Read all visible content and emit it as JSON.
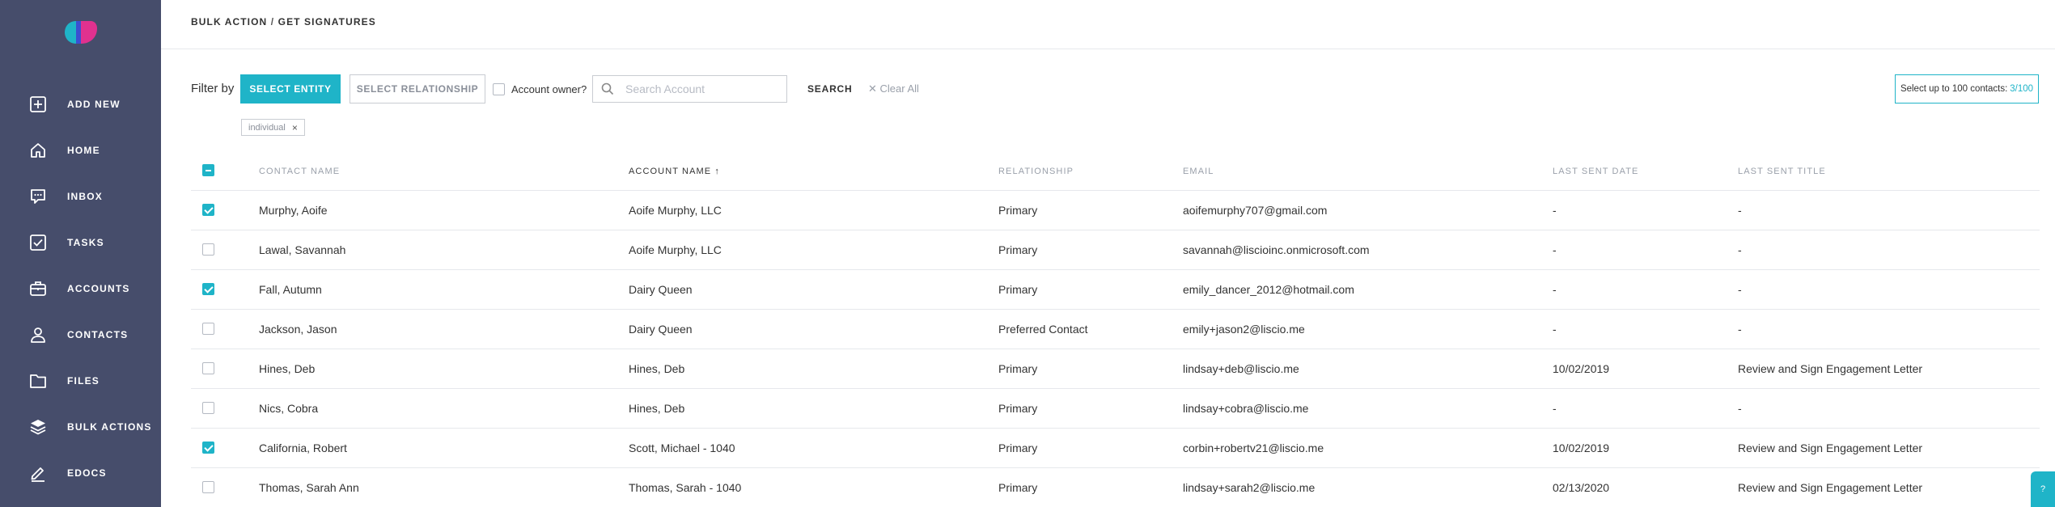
{
  "sidebar": {
    "items": [
      {
        "label": "ADD NEW",
        "icon": "plus-square-icon"
      },
      {
        "label": "HOME",
        "icon": "home-icon"
      },
      {
        "label": "INBOX",
        "icon": "message-icon"
      },
      {
        "label": "TASKS",
        "icon": "checkbox-icon"
      },
      {
        "label": "ACCOUNTS",
        "icon": "briefcase-icon"
      },
      {
        "label": "CONTACTS",
        "icon": "user-icon"
      },
      {
        "label": "FILES",
        "icon": "folder-icon"
      },
      {
        "label": "BULK ACTIONS",
        "icon": "layers-icon"
      },
      {
        "label": "EDOCS",
        "icon": "pen-icon"
      }
    ]
  },
  "breadcrumb": {
    "part1": "BULK ACTION",
    "separator": "/",
    "part2": "GET SIGNATURES"
  },
  "filters": {
    "label": "Filter by",
    "entity_button": "SELECT ENTITY",
    "relationship_button": "SELECT RELATIONSHIP",
    "account_owner_label": "Account owner?",
    "search_placeholder": "Search Account",
    "search_button": "SEARCH",
    "clear_all": "Clear All",
    "clear_icon": "✕",
    "active_tag": "individual",
    "tag_remove": "×"
  },
  "selection": {
    "label": "Select up to 100 contacts:",
    "count": "3/100"
  },
  "table": {
    "headers": {
      "contact": "CONTACT NAME",
      "account": "ACCOUNT NAME",
      "sort_indicator": "↑",
      "relationship": "RELATIONSHIP",
      "email": "EMAIL",
      "last_sent_date": "LAST SENT DATE",
      "last_sent_title": "LAST SENT TITLE"
    },
    "rows": [
      {
        "checked": true,
        "contact": "Murphy, Aoife",
        "account": "Aoife Murphy, LLC",
        "relationship": "Primary",
        "email": "aoifemurphy707@gmail.com",
        "date": "-",
        "title": "-"
      },
      {
        "checked": false,
        "contact": "Lawal, Savannah",
        "account": "Aoife Murphy, LLC",
        "relationship": "Primary",
        "email": "savannah@liscioinc.onmicrosoft.com",
        "date": "-",
        "title": "-"
      },
      {
        "checked": true,
        "contact": "Fall, Autumn",
        "account": "Dairy Queen",
        "relationship": "Primary",
        "email": "emily_dancer_2012@hotmail.com",
        "date": "-",
        "title": "-"
      },
      {
        "checked": false,
        "contact": "Jackson, Jason",
        "account": "Dairy Queen",
        "relationship": "Preferred Contact",
        "email": "emily+jason2@liscio.me",
        "date": "-",
        "title": "-"
      },
      {
        "checked": false,
        "contact": "Hines, Deb",
        "account": "Hines, Deb",
        "relationship": "Primary",
        "email": "lindsay+deb@liscio.me",
        "date": "10/02/2019",
        "title": "Review and Sign Engagement Letter"
      },
      {
        "checked": false,
        "contact": "Nics, Cobra",
        "account": "Hines, Deb",
        "relationship": "Primary",
        "email": "lindsay+cobra@liscio.me",
        "date": "-",
        "title": "-"
      },
      {
        "checked": true,
        "contact": "California, Robert",
        "account": "Scott, Michael - 1040",
        "relationship": "Primary",
        "email": "corbin+robertv21@liscio.me",
        "date": "10/02/2019",
        "title": "Review and Sign Engagement Letter"
      },
      {
        "checked": false,
        "contact": "Thomas, Sarah Ann",
        "account": "Thomas, Sarah - 1040",
        "relationship": "Primary",
        "email": "lindsay+sarah2@liscio.me",
        "date": "02/13/2020",
        "title": "Review and Sign Engagement Letter"
      }
    ]
  },
  "colors": {
    "sidebar_bg": "#464d6b",
    "accent": "#1fb4c8"
  }
}
